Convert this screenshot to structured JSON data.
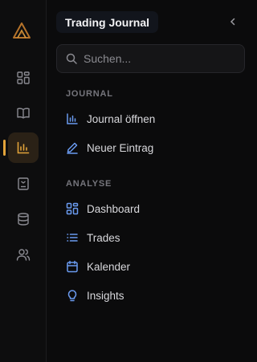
{
  "rail": {
    "items": [
      {
        "icon": "layout-grid-icon"
      },
      {
        "icon": "book-open-icon"
      },
      {
        "icon": "bar-chart-icon",
        "active": true
      },
      {
        "icon": "notebook-icon"
      },
      {
        "icon": "database-icon"
      },
      {
        "icon": "users-icon"
      }
    ],
    "accent": "#e2a33a"
  },
  "panel": {
    "title": "Trading Journal",
    "search": {
      "placeholder": "Suchen..."
    },
    "sections": [
      {
        "label": "JOURNAL",
        "items": [
          {
            "label": "Journal öffnen",
            "icon": "bar-chart-icon"
          },
          {
            "label": "Neuer Eintrag",
            "icon": "pencil-icon"
          }
        ]
      },
      {
        "label": "ANALYSE",
        "items": [
          {
            "label": "Dashboard",
            "icon": "layout-grid-icon"
          },
          {
            "label": "Trades",
            "icon": "list-icon"
          },
          {
            "label": "Kalender",
            "icon": "calendar-icon"
          },
          {
            "label": "Insights",
            "icon": "lightbulb-icon"
          }
        ]
      }
    ],
    "icon_color": "#6b9bf0"
  }
}
